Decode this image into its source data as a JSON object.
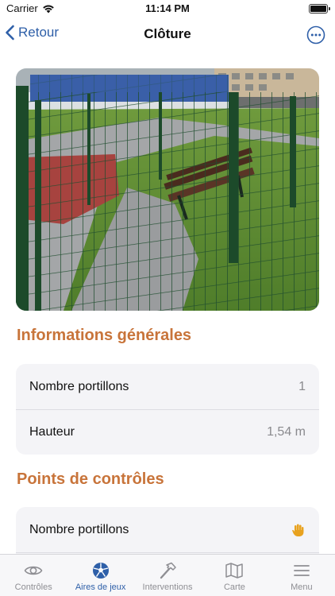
{
  "status_bar": {
    "carrier": "Carrier",
    "time": "11:14 PM"
  },
  "nav": {
    "back_label": "Retour",
    "title": "Clôture"
  },
  "photo": {
    "icon": "fence-photo"
  },
  "sections": {
    "general": {
      "title": "Informations générales",
      "rows": [
        {
          "label": "Nombre portillons",
          "value": "1"
        },
        {
          "label": "Hauteur",
          "value": "1,54 m"
        }
      ]
    },
    "controls": {
      "title": "Points de contrôles",
      "rows": [
        {
          "label": "Nombre portillons",
          "icon": "hand-icon"
        }
      ]
    }
  },
  "tabs": [
    {
      "label": "Contrôles",
      "icon": "eye-icon",
      "active": false
    },
    {
      "label": "Aires de jeux",
      "icon": "ball-icon",
      "active": true
    },
    {
      "label": "Interventions",
      "icon": "hammer-icon",
      "active": false
    },
    {
      "label": "Carte",
      "icon": "map-icon",
      "active": false
    },
    {
      "label": "Menu",
      "icon": "menu-icon",
      "active": false
    }
  ],
  "colors": {
    "accent": "#2e5fa8",
    "section_title": "#c8743a",
    "card_bg": "#f4f4f7",
    "hand_icon": "#e8a21f"
  }
}
